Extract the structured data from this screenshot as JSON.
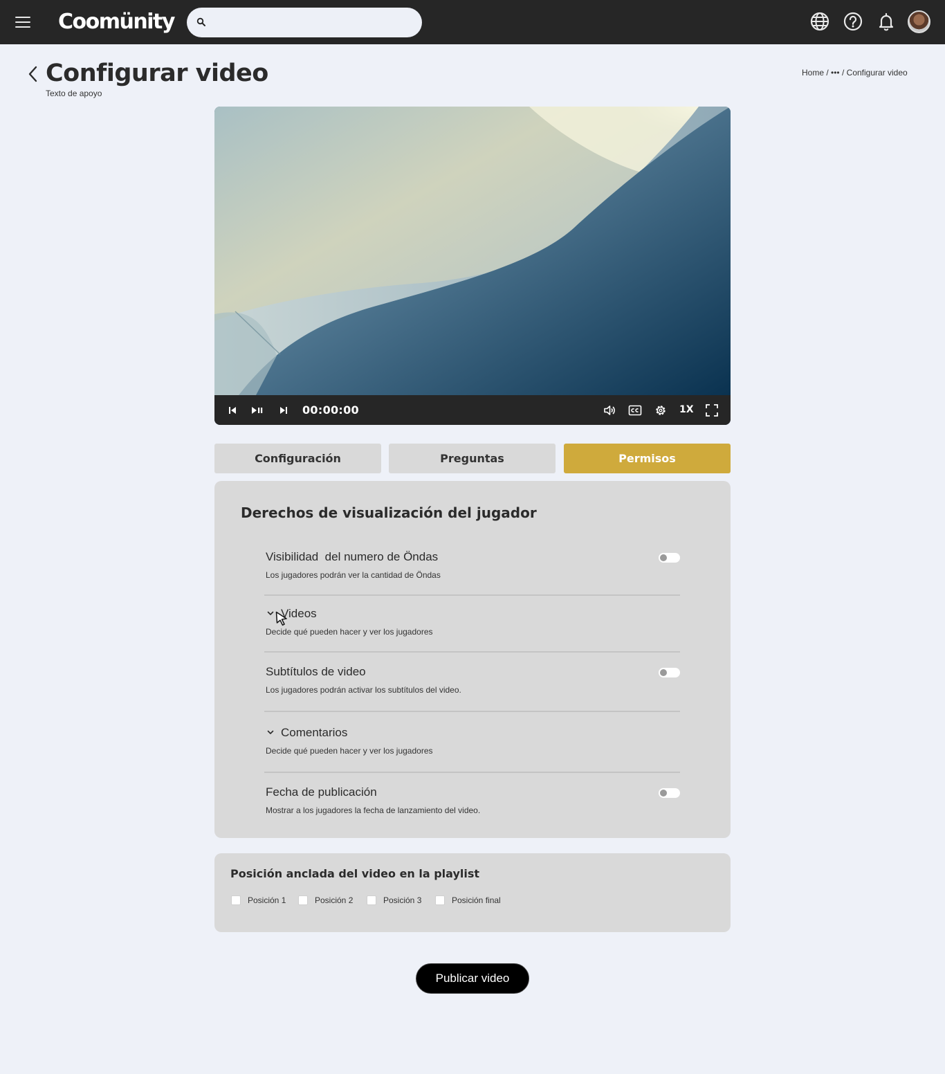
{
  "app": {
    "logo_text": "Coomünity",
    "brand_color": "#cfaa3c",
    "topbar_color": "#262626",
    "search_placeholder": "",
    "icons": [
      "menu-icon",
      "search-icon",
      "globe-icon",
      "help-icon",
      "bell-icon"
    ]
  },
  "page": {
    "title": "Configurar video",
    "subtitle": "Texto de apoyo",
    "breadcrumb": {
      "home": "Home",
      "ellipsis": "•••",
      "current": "Configurar video"
    }
  },
  "player": {
    "time": "00:00:00",
    "speed": "1X",
    "controls": [
      "skip-previous-icon",
      "play-pause-icon",
      "skip-next-icon",
      "volume-icon",
      "captions-icon",
      "settings-icon",
      "fullscreen-icon"
    ]
  },
  "tabs": [
    {
      "label": "Configuración",
      "active": false
    },
    {
      "label": "Preguntas",
      "active": false
    },
    {
      "label": "Permisos",
      "active": true
    }
  ],
  "permissions": {
    "title": "Derechos de visualización del jugador",
    "items": [
      {
        "title": "Visibilidad  del numero de Öndas",
        "desc": "Los jugadores podrán ver la cantidad de Öndas",
        "control": "toggle",
        "enabled": false
      },
      {
        "title": "Videos",
        "desc": "Decide qué pueden hacer y ver los jugadores",
        "control": "expand"
      },
      {
        "title": "Subtítulos de video",
        "desc": "Los jugadores podrán activar los subtítulos del video.",
        "control": "toggle",
        "enabled": false
      },
      {
        "title": "Comentarios",
        "desc": "Decide qué pueden hacer y ver los jugadores",
        "control": "expand"
      },
      {
        "title": "Fecha de publicación",
        "desc": "Mostrar a los jugadores la fecha de lanzamiento del video.",
        "control": "toggle",
        "enabled": false
      }
    ]
  },
  "playlist": {
    "title": "Posición anclada del video en la playlist",
    "options": [
      {
        "label": "Posición 1",
        "checked": false
      },
      {
        "label": "Posición 2",
        "checked": false
      },
      {
        "label": "Posición 3",
        "checked": false
      },
      {
        "label": "Posición final",
        "checked": false
      }
    ]
  },
  "actions": {
    "publish_label": "Publicar video"
  }
}
